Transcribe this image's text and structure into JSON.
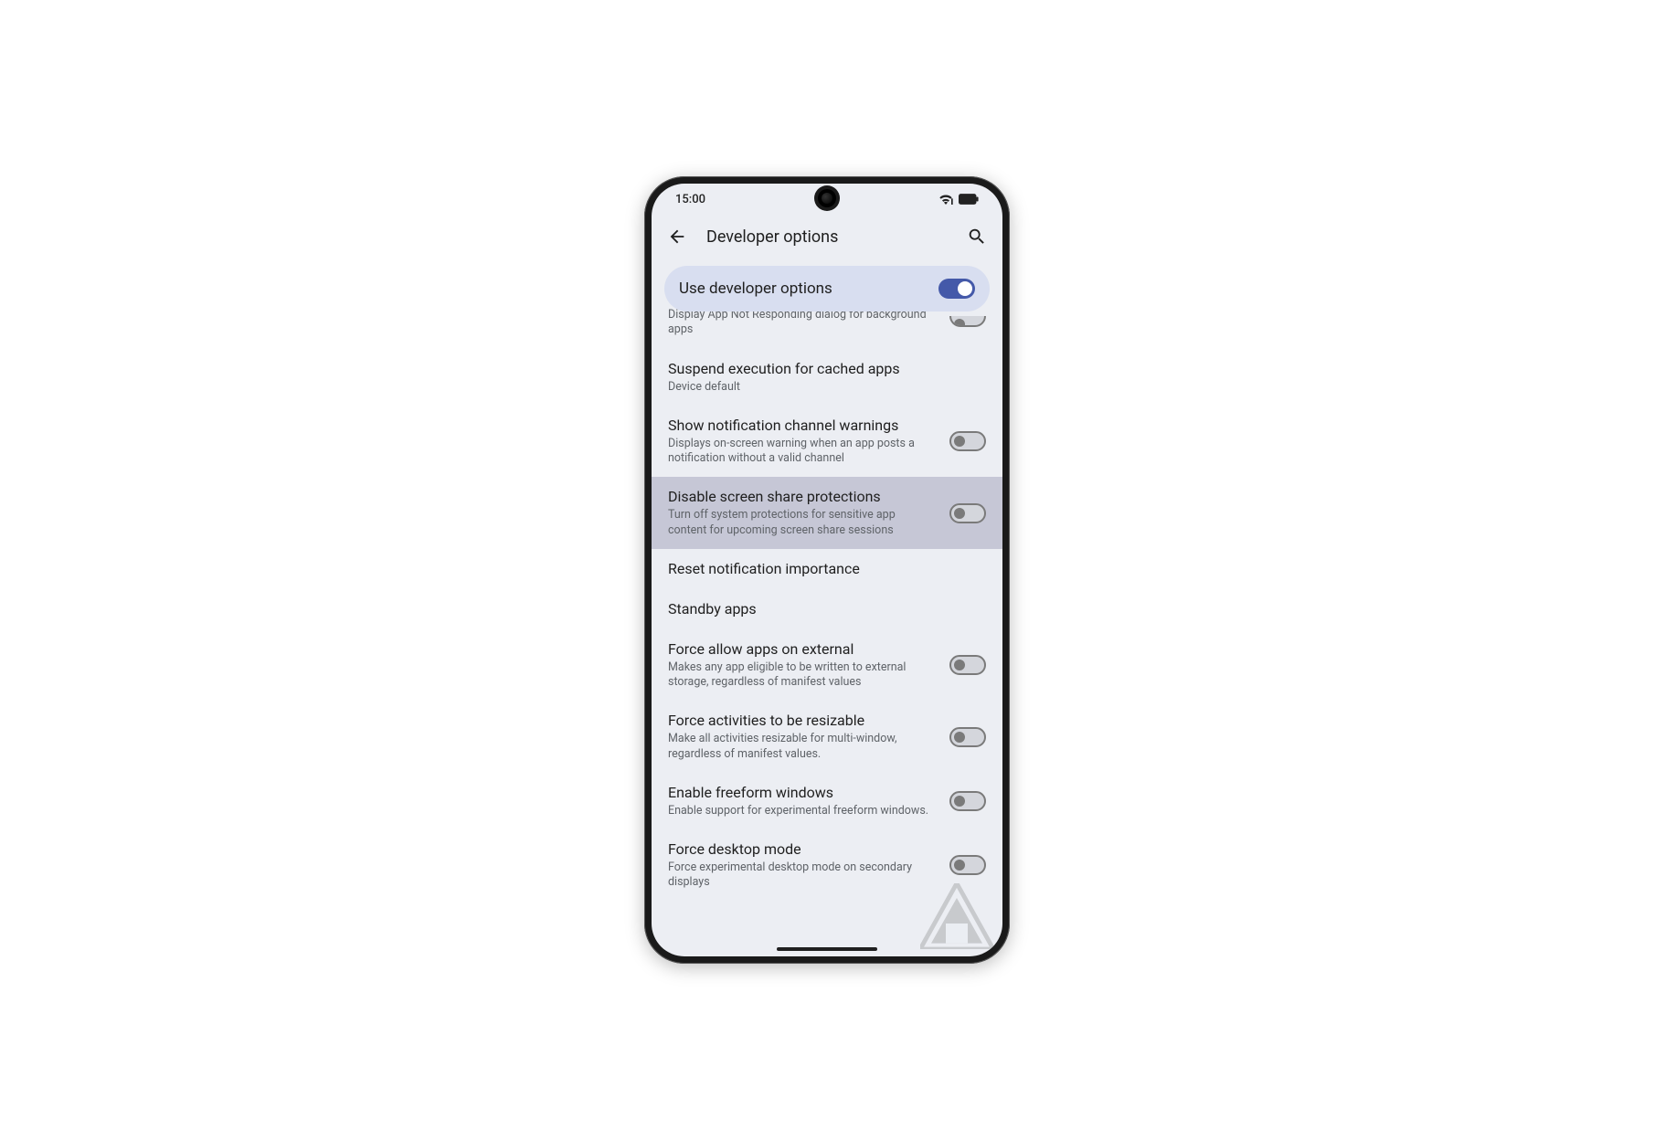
{
  "status": {
    "time": "15:00"
  },
  "header": {
    "title": "Developer options"
  },
  "master": {
    "label": "Use developer options",
    "on": true
  },
  "rows": {
    "anr": {
      "sub": "Display App Not Responding dialog for background apps"
    },
    "suspend": {
      "title": "Suspend execution for cached apps",
      "sub": "Device default"
    },
    "channel_warn": {
      "title": "Show notification channel warnings",
      "sub": "Displays on-screen warning when an app posts a notification without a valid channel"
    },
    "disable_share": {
      "title": "Disable screen share protections",
      "sub": "Turn off system protections for sensitive app content for upcoming screen share sessions"
    },
    "reset_notif": {
      "title": "Reset notification importance"
    },
    "standby": {
      "title": "Standby apps"
    },
    "force_external": {
      "title": "Force allow apps on external",
      "sub": "Makes any app eligible to be written to external storage, regardless of manifest values"
    },
    "force_resize": {
      "title": "Force activities to be resizable",
      "sub": "Make all activities resizable for multi-window, regardless of manifest values."
    },
    "freeform": {
      "title": "Enable freeform windows",
      "sub": "Enable support for experimental freeform windows."
    },
    "desktop": {
      "title": "Force desktop mode",
      "sub": "Force experimental desktop mode on secondary displays"
    }
  }
}
